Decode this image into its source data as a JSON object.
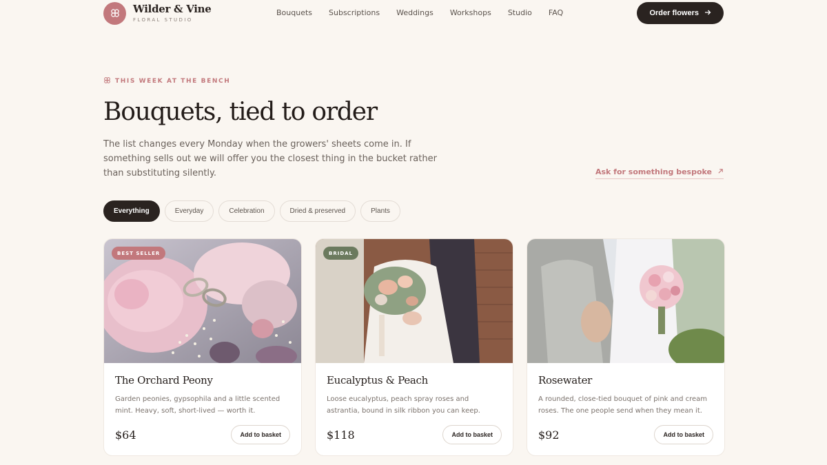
{
  "brand": {
    "name": "Wilder & Vine",
    "subtitle": "FLORAL STUDIO",
    "logo_icon": "flower-icon",
    "color": "#c2787c"
  },
  "nav": {
    "items": [
      "Bouquets",
      "Subscriptions",
      "Weddings",
      "Workshops",
      "Studio",
      "FAQ"
    ]
  },
  "header": {
    "cta_label": "Order flowers",
    "cta_icon": "arrow-right-icon"
  },
  "hero": {
    "eyebrow": "THIS WEEK AT THE BENCH",
    "eyebrow_icon": "flower-icon",
    "title": "Bouquets, tied to order",
    "lede": "The list changes every Monday when the growers' sheets come in. If something sells out we will offer you the closest thing in the bucket rather than substituting silently.",
    "bespoke_link": "Ask for something bespoke",
    "bespoke_icon": "arrow-up-right-icon"
  },
  "filters": {
    "items": [
      "Everything",
      "Everyday",
      "Celebration",
      "Dried & preserved",
      "Plants"
    ],
    "active": "Everything"
  },
  "products": [
    {
      "badge": "BEST SELLER",
      "badge_color": "#c2787c",
      "title": "The Orchard Peony",
      "description": "Garden peonies, gypsophila and a little scented mint. Heavy, soft, short-lived — worth it.",
      "price": "$64",
      "button": "Add to basket",
      "image": "peony-rings-photo"
    },
    {
      "badge": "BRIDAL",
      "badge_color": "#6b7a5e",
      "title": "Eucalyptus & Peach",
      "description": "Loose eucalyptus, peach spray roses and astrantia, bound in silk ribbon you can keep.",
      "price": "$118",
      "button": "Add to basket",
      "image": "bride-bouquet-photo"
    },
    {
      "badge": "",
      "badge_color": "",
      "title": "Rosewater",
      "description": "A rounded, close-tied bouquet of pink and cream roses. The one people send when they mean it.",
      "price": "$92",
      "button": "Add to basket",
      "image": "couple-rose-bouquet-photo"
    }
  ],
  "colors": {
    "background": "#faf6f1",
    "ink": "#2a2320",
    "accent": "#c2787c"
  }
}
